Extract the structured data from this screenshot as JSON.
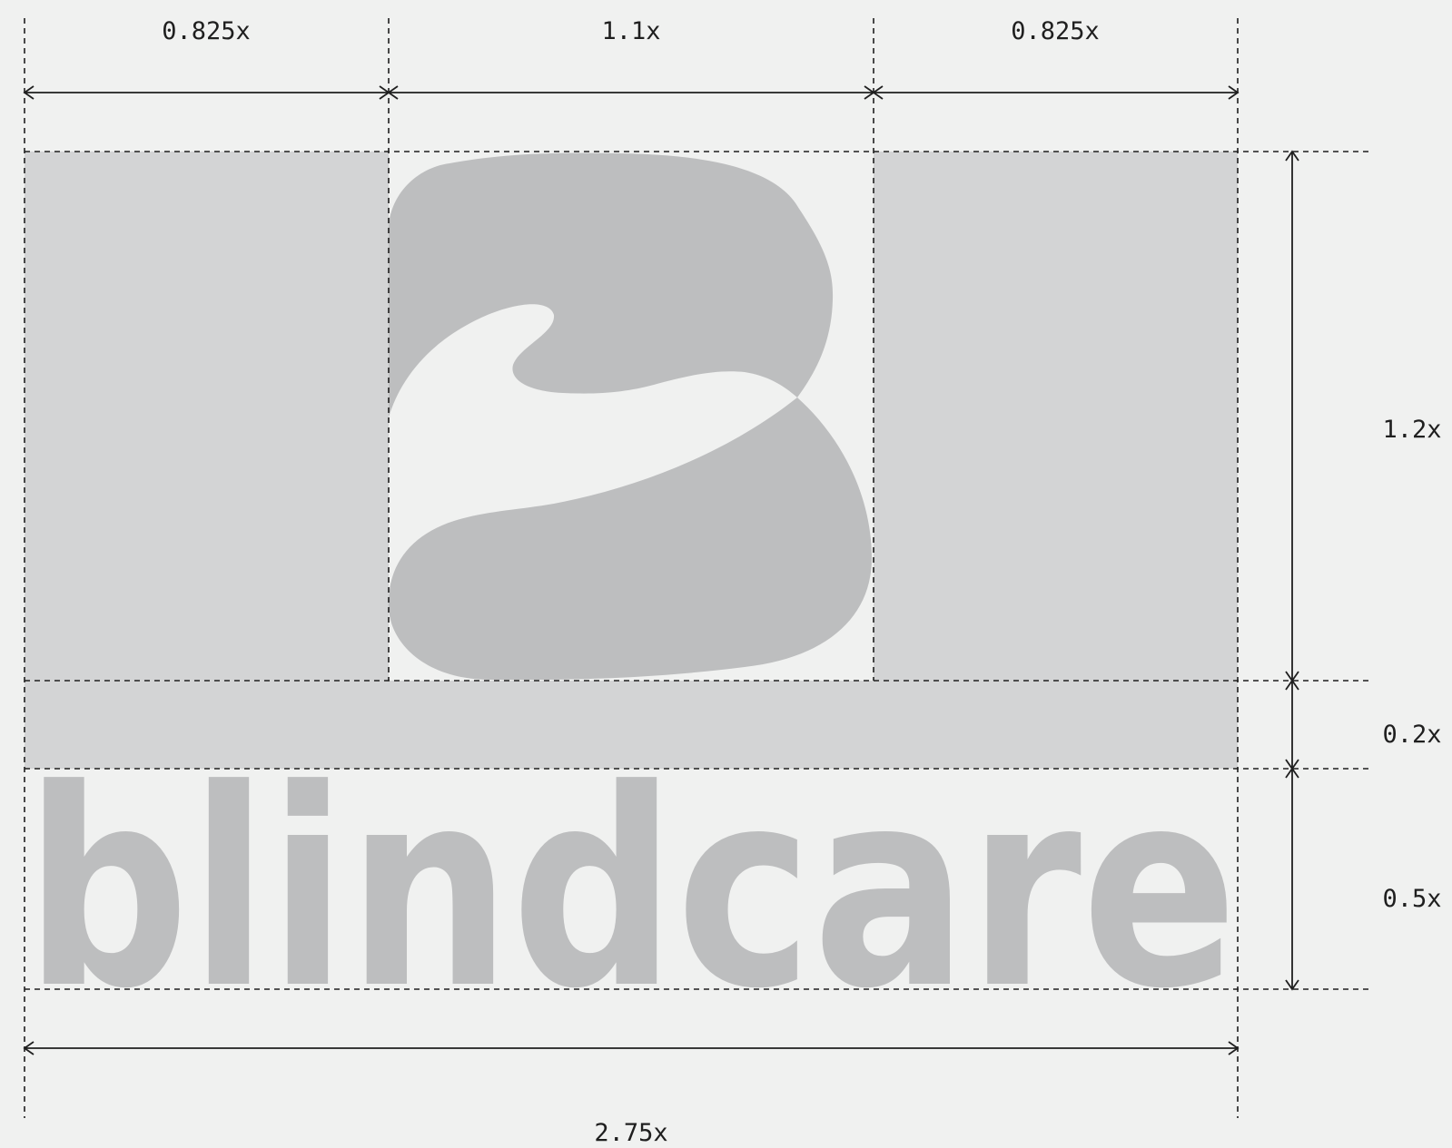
{
  "diagram": {
    "wordmark": "blindcare",
    "dimensions": {
      "top_left": "0.825x",
      "top_center": "1.1x",
      "top_right": "0.825x",
      "right_mark_height": "1.2x",
      "right_gap": "0.2x",
      "right_wordmark_height": "0.5x",
      "bottom_total_width": "2.75x"
    },
    "colors": {
      "background": "#f0f1f0",
      "clear_space": "#d3d4d5",
      "logo": "#bdbebf",
      "lines": "#1f1f1f"
    }
  }
}
